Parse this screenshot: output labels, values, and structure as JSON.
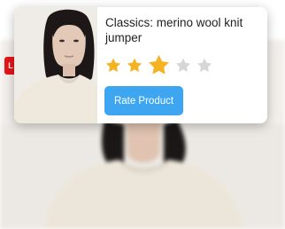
{
  "product": {
    "title": "Classics: merino wool knit jumper"
  },
  "rating": {
    "value": 3,
    "max": 5,
    "filled_color": "#f5b324",
    "empty_color": "#d6d6d6",
    "icon": "star-icon"
  },
  "actions": {
    "rate_label": "Rate Product"
  },
  "badge": {
    "label": "L",
    "color": "#e8141b"
  },
  "colors": {
    "accent": "#3ea5f0"
  }
}
